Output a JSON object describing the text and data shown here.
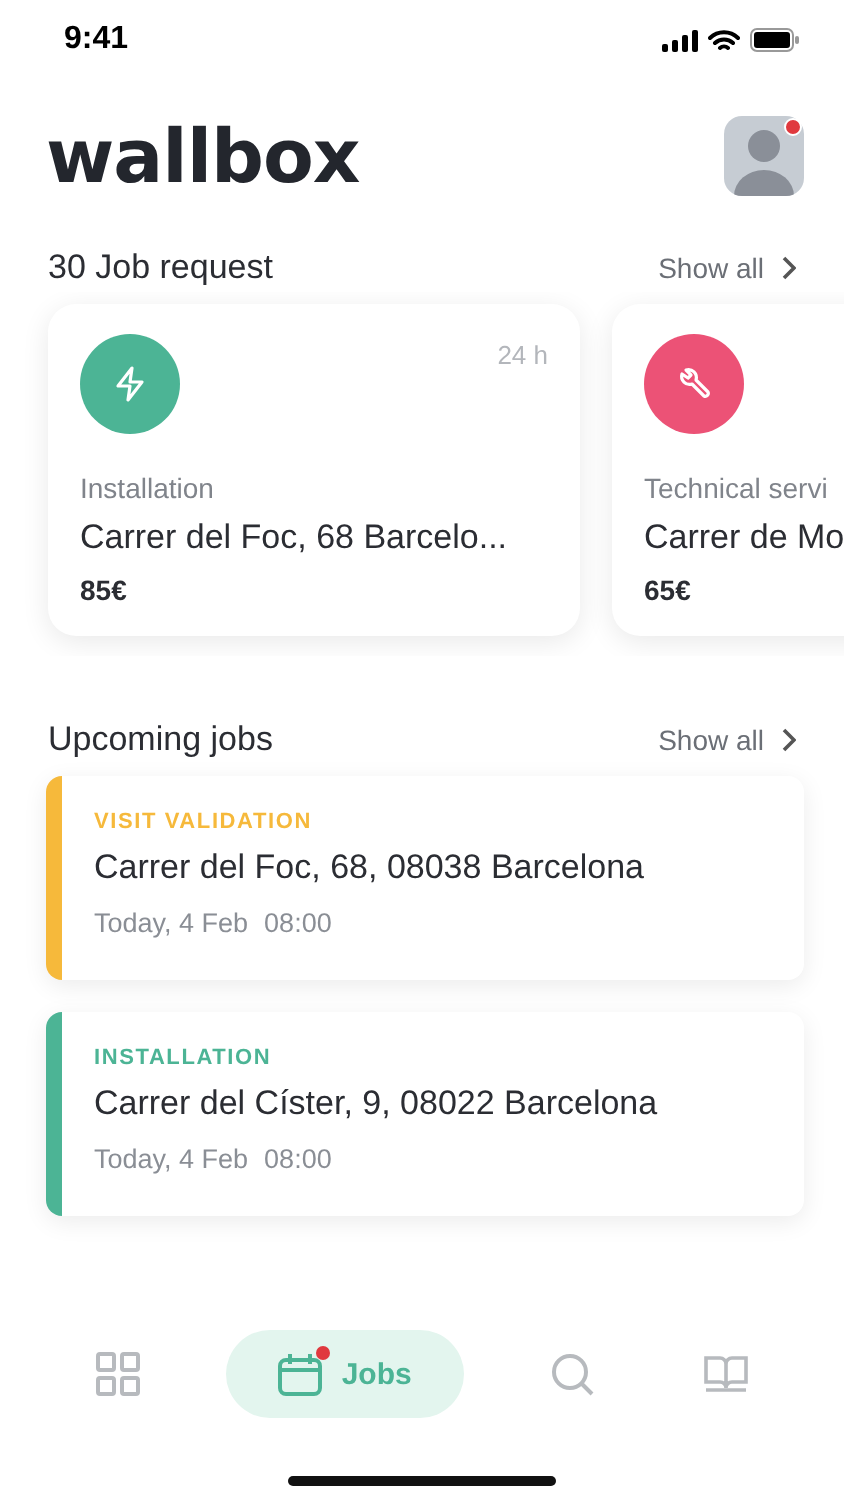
{
  "status_bar": {
    "time": "9:41"
  },
  "header": {
    "logo": "wallbox",
    "avatar": {
      "notification": true
    }
  },
  "job_requests": {
    "title": "30 Job request",
    "show_all": "Show all",
    "cards": [
      {
        "kind": "installation",
        "color": "#4cb495",
        "category": "Installation",
        "address": "Carrer del Foc, 68 Barcelo...",
        "price": "85€",
        "time": "24 h"
      },
      {
        "kind": "technical",
        "color": "#ec5276",
        "category": "Technical servi",
        "address": "Carrer de Mo",
        "price": "65€"
      }
    ]
  },
  "upcoming_jobs": {
    "title": "Upcoming jobs",
    "show_all": "Show all",
    "items": [
      {
        "type": "VISIT VALIDATION",
        "color": "#f6b93b",
        "address": "Carrer del Foc, 68, 08038 Barcelona",
        "date": "Today, 4 Feb",
        "time": "08:00"
      },
      {
        "type": "INSTALLATION",
        "color": "#4cb495",
        "address": "Carrer del Císter, 9, 08022 Barcelona",
        "date": "Today, 4 Feb",
        "time": "08:00"
      }
    ]
  },
  "tab_bar": [
    {
      "kind": "dashboard",
      "selected": false,
      "badge": false
    },
    {
      "kind": "calendar",
      "label": "Jobs",
      "selected": true,
      "badge": true
    },
    {
      "kind": "search",
      "selected": false,
      "badge": false
    },
    {
      "kind": "book",
      "selected": false,
      "badge": false
    }
  ]
}
